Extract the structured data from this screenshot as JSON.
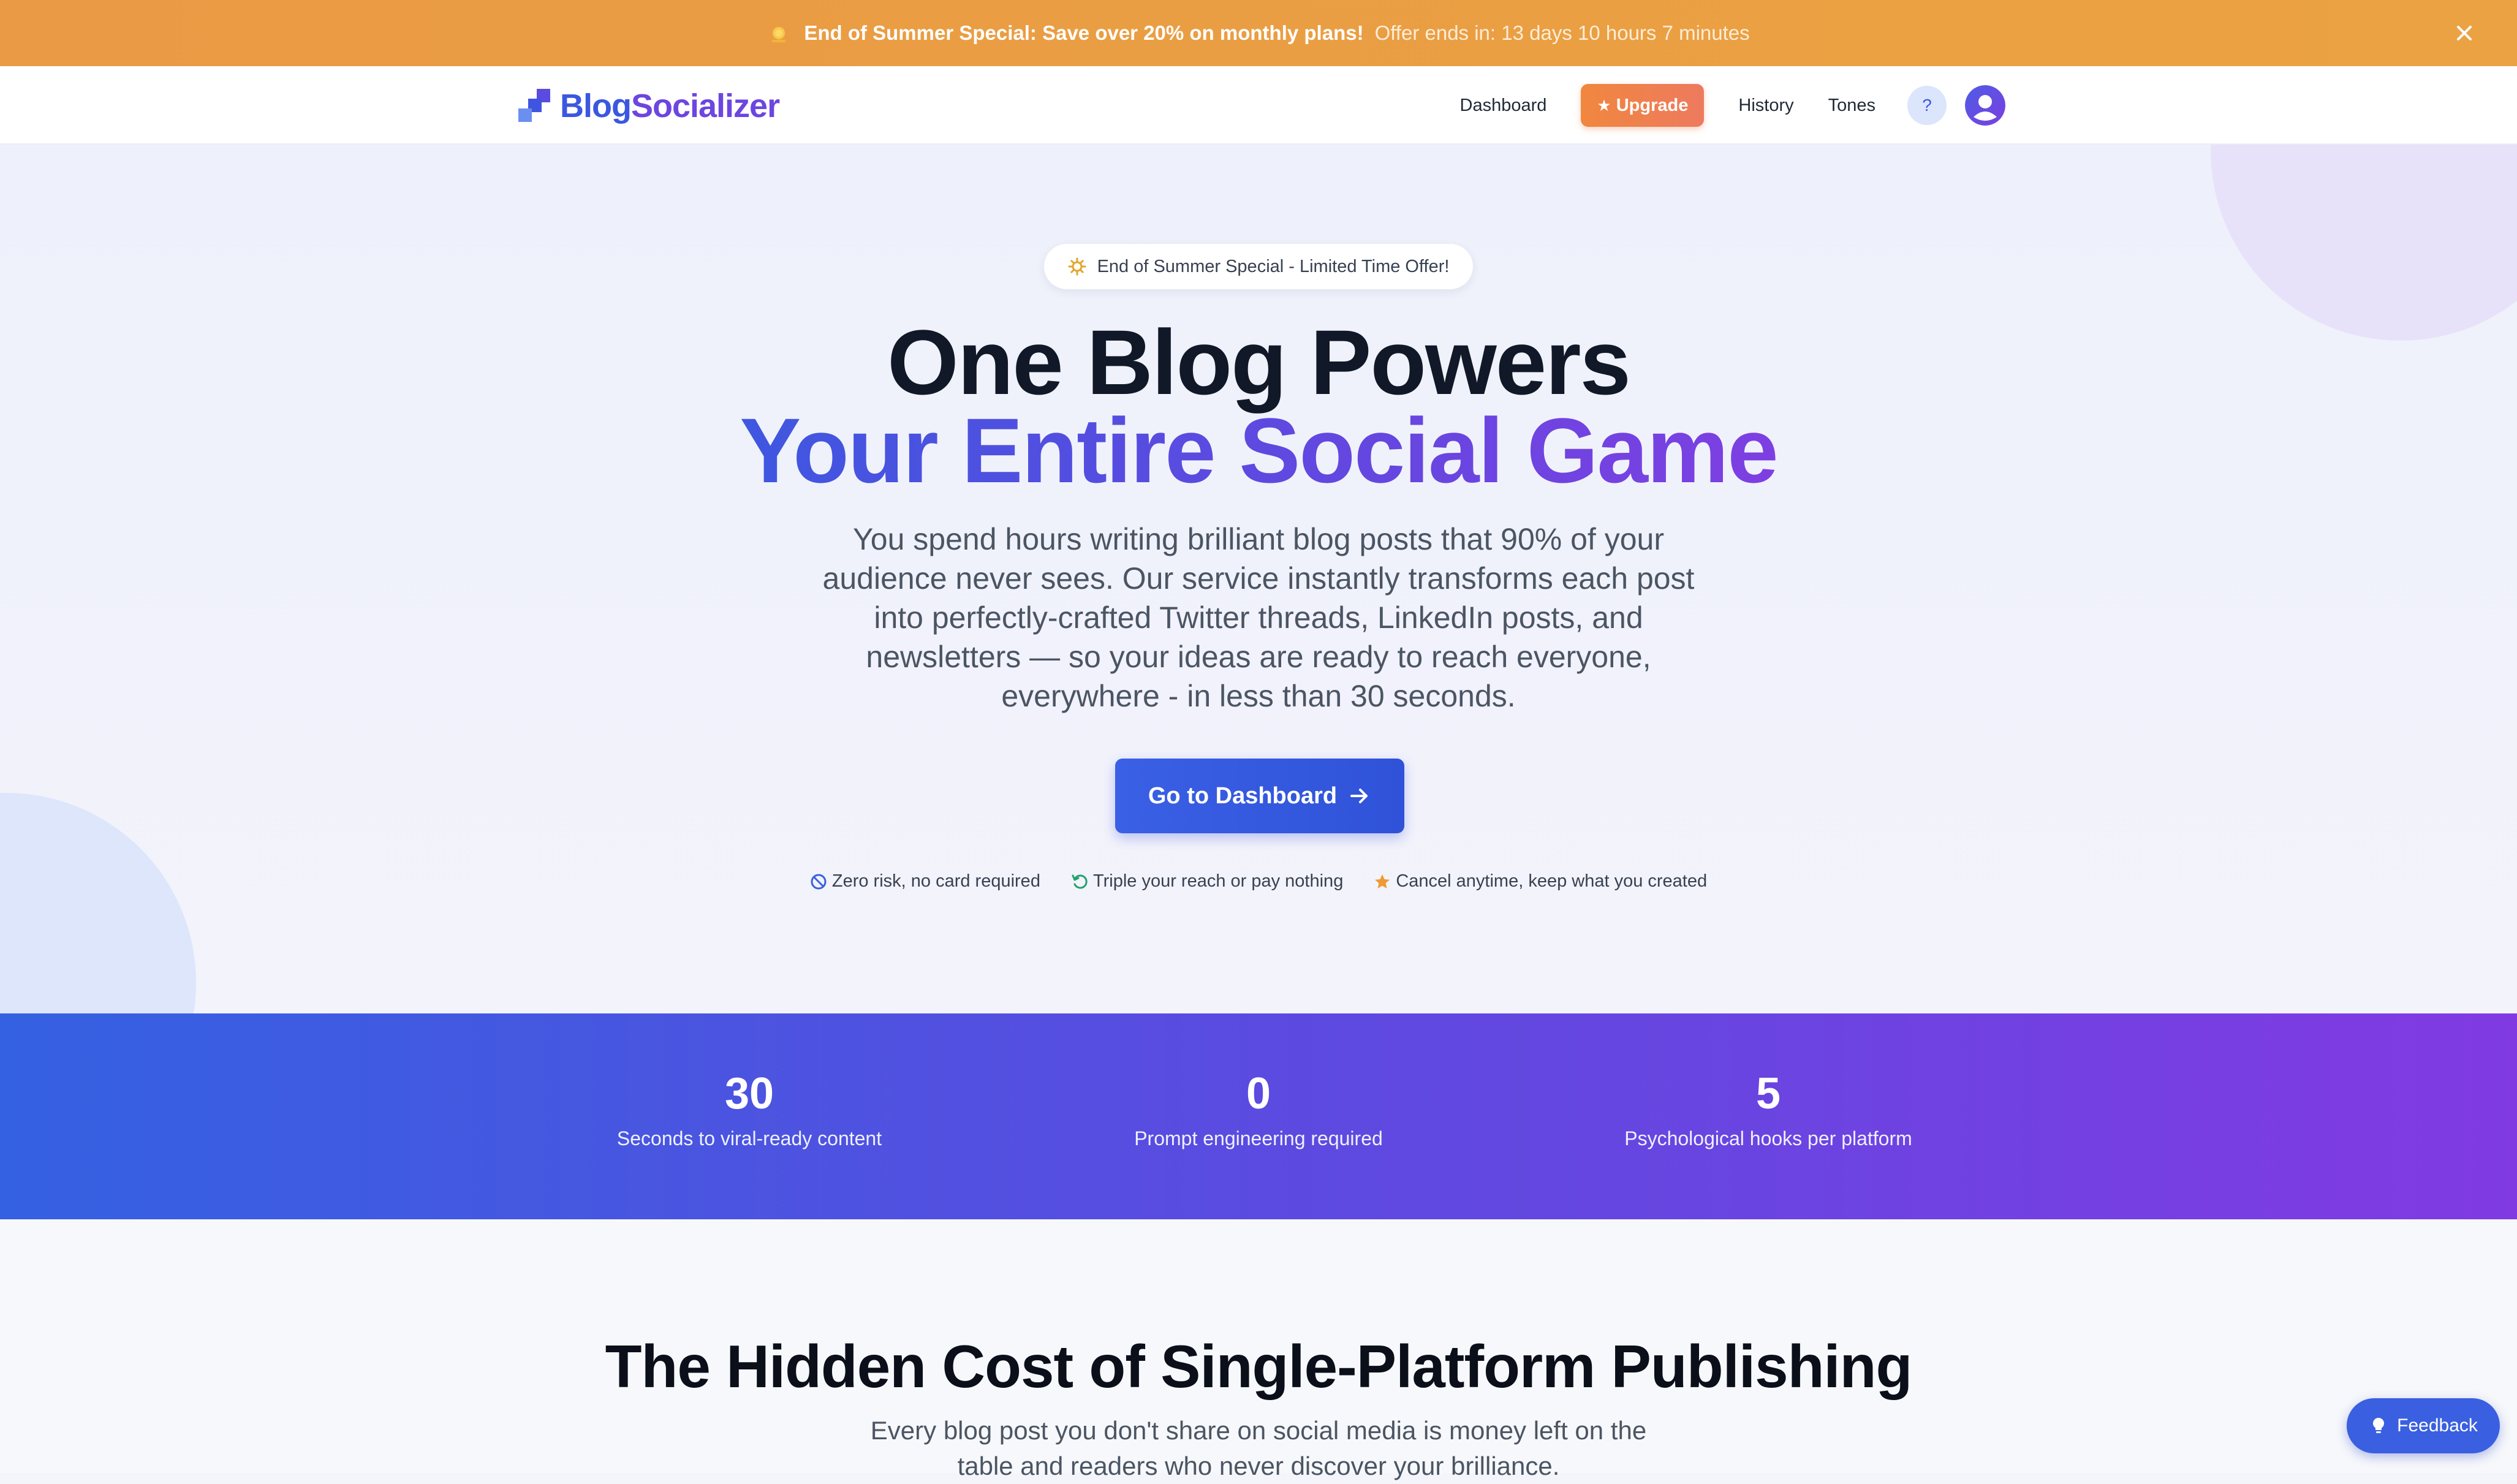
{
  "banner": {
    "headline": "End of Summer Special: Save over 20% on monthly plans!",
    "countdown": "Offer ends in: 13 days 10 hours 7 minutes",
    "icon": "sun-icon",
    "close_icon": "close-icon"
  },
  "header": {
    "logo_part1": "Blog",
    "logo_part2": "Socializer",
    "nav": {
      "dashboard": "Dashboard",
      "upgrade": "Upgrade",
      "history": "History",
      "tones": "Tones",
      "help": "?"
    }
  },
  "hero": {
    "badge": "End of Summer Special - Limited Time Offer!",
    "title_line1": "One Blog Powers",
    "title_line2": "Your Entire Social Game",
    "subtitle": "You spend hours writing brilliant blog posts that 90% of your audience never sees. Our service instantly transforms each post into perfectly-crafted Twitter threads, LinkedIn posts, and newsletters — so your ideas are ready to reach everyone, everywhere - in less than 30 seconds.",
    "cta": "Go to Dashboard",
    "trust": [
      {
        "icon": "ban-icon",
        "text": "Zero risk, no card required"
      },
      {
        "icon": "refresh-icon",
        "text": "Triple your reach or pay nothing"
      },
      {
        "icon": "star-icon",
        "text": "Cancel anytime, keep what you created"
      }
    ]
  },
  "stats": [
    {
      "value": "30",
      "label": "Seconds to viral-ready content"
    },
    {
      "value": "0",
      "label": "Prompt engineering required"
    },
    {
      "value": "5",
      "label": "Psychological hooks per platform"
    }
  ],
  "section": {
    "title": "The Hidden Cost of Single-Platform Publishing",
    "subtitle": "Every blog post you don't share on social media is money left on the table and readers who never discover your brilliance."
  },
  "feedback": {
    "label": "Feedback"
  },
  "colors": {
    "banner": "#ea9a44",
    "primary": "#3a5fe0",
    "accent_purple": "#7e3fe2",
    "upgrade": "#f0873e"
  }
}
